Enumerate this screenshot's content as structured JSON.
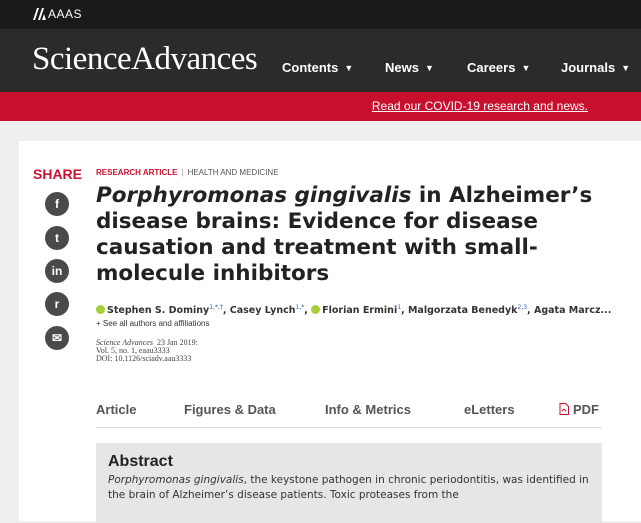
{
  "topbar": {
    "org": "AAAS"
  },
  "header": {
    "brand": "ScienceAdvances",
    "nav": [
      {
        "label": "Contents"
      },
      {
        "label": "News"
      },
      {
        "label": "Careers"
      },
      {
        "label": "Journals"
      }
    ]
  },
  "banner": {
    "link": "Read our COVID-19 research and news."
  },
  "share": {
    "label": "SHARE",
    "icons": [
      "facebook-icon",
      "twitter-icon",
      "linkedin-icon",
      "reddit-icon",
      "email-icon"
    ],
    "glyphs": [
      "f",
      "t",
      "in",
      "r",
      "✉"
    ]
  },
  "article": {
    "type": "RESEARCH ARTICLE",
    "separator": "|",
    "subject": "HEALTH AND MEDICINE",
    "title_italic": "Porphyromonas gingivalis",
    "title_rest": " in Alzheimer’s disease brains: Evidence for disease causation and treatment with small-molecule inhibitors",
    "authors": [
      {
        "name": "Stephen S. Dominy",
        "sup": "1,*,†",
        "orcid": true
      },
      {
        "name": "Casey Lynch",
        "sup": "1,*",
        "orcid": false
      },
      {
        "name": "Florian Ermini",
        "sup": "1",
        "orcid": true
      },
      {
        "name": "Malgorzata Benedyk",
        "sup": "2,3",
        "orcid": false
      },
      {
        "name": "Agata Marcz...",
        "sup": "",
        "orcid": false
      }
    ],
    "see_all": "+ See all authors and affiliations",
    "journal": "Science Advances",
    "date": "23 Jan 2019:",
    "volume": "Vol. 5, no. 1, eaau3333",
    "doi": "DOI: 10.1126/sciadv.aau3333"
  },
  "tabs": [
    {
      "label": "Article"
    },
    {
      "label": "Figures & Data"
    },
    {
      "label": "Info & Metrics"
    },
    {
      "label": "eLetters"
    },
    {
      "label": "PDF"
    }
  ],
  "abstract": {
    "heading": "Abstract",
    "text_italic": "Porphyromonas gingivalis",
    "text_rest": ", the keystone pathogen in chronic periodontitis, was identified in the brain of Alzheimer’s disease patients. Toxic proteases from the"
  }
}
